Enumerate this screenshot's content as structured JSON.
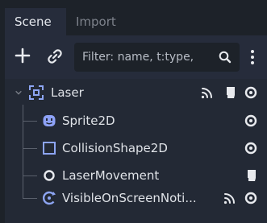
{
  "tabs": [
    {
      "label": "Scene",
      "active": true
    },
    {
      "label": "Import",
      "active": false
    }
  ],
  "toolbar": {
    "add_icon": "plus-icon",
    "link_icon": "link-icon",
    "filter_placeholder": "Filter: name, t:type,",
    "search_icon": "search-icon",
    "menu_icon": "kebab-menu-icon"
  },
  "tree": {
    "nodes": [
      {
        "label": "Laser",
        "icon": "node2d-icon",
        "expanded": true,
        "badges": [
          "signal-icon",
          "script-icon",
          "visibility-eye-icon"
        ]
      },
      {
        "label": "Sprite2D",
        "icon": "sprite2d-icon",
        "badges": [
          "visibility-eye-icon"
        ]
      },
      {
        "label": "CollisionShape2D",
        "icon": "collisionshape2d-icon",
        "badges": [
          "visibility-eye-icon"
        ]
      },
      {
        "label": "LaserMovement",
        "icon": "node-icon",
        "badges": [
          "script-icon"
        ]
      },
      {
        "label": "VisibleOnScreenNoti...",
        "icon": "visibleonscreennotifier-icon",
        "badges": [
          "signal-icon",
          "visibility-eye-icon"
        ]
      }
    ]
  },
  "colors": {
    "background": "#1d2229",
    "panel": "#262c3b",
    "tree_bg": "#232935",
    "node2d_blue": "#8da5f3",
    "sprite_blue": "#8ea2f7",
    "text": "#dfe2e7"
  }
}
